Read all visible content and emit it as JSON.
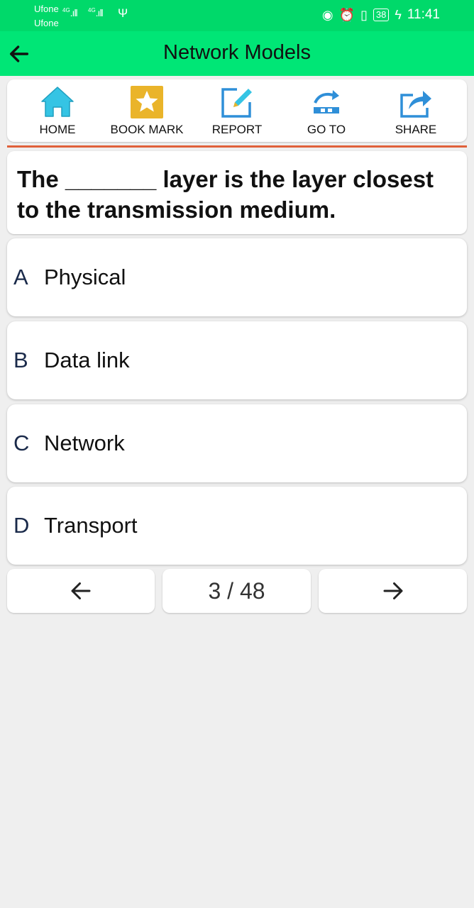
{
  "status_bar": {
    "carrier_1": "Ufone",
    "carrier_2": "Ufone",
    "network_1": "4G",
    "network_2": "4G",
    "battery": "38",
    "time": "11:41"
  },
  "app_bar": {
    "title": "Network Models",
    "back_icon": "arrow-left-icon"
  },
  "toolbar": {
    "items": [
      {
        "label": "HOME",
        "icon": "home-icon"
      },
      {
        "label": "BOOK MARK",
        "icon": "star-icon"
      },
      {
        "label": "REPORT",
        "icon": "edit-icon"
      },
      {
        "label": "GO TO",
        "icon": "redo-icon"
      },
      {
        "label": "SHARE",
        "icon": "share-icon"
      }
    ]
  },
  "question": {
    "text": "The _______ layer is the layer closest to the transmission medium."
  },
  "options": [
    {
      "letter": "A",
      "text": "Physical"
    },
    {
      "letter": "B",
      "text": "Data link"
    },
    {
      "letter": "C",
      "text": "Network"
    },
    {
      "letter": "D",
      "text": "Transport"
    }
  ],
  "navigation": {
    "page_current": 3,
    "page_total": 48,
    "page_label": "3 / 48",
    "prev_icon": "arrow-left-icon",
    "next_icon": "arrow-right-icon"
  },
  "colors": {
    "status_bar": "#00d96a",
    "app_bar": "#00e676",
    "divider": "#e0603a",
    "home": "#35c4e4",
    "bookmark": "#eab42a",
    "report": "#2f8fd8",
    "goto": "#2f8fd8",
    "share": "#2f8fd8"
  }
}
